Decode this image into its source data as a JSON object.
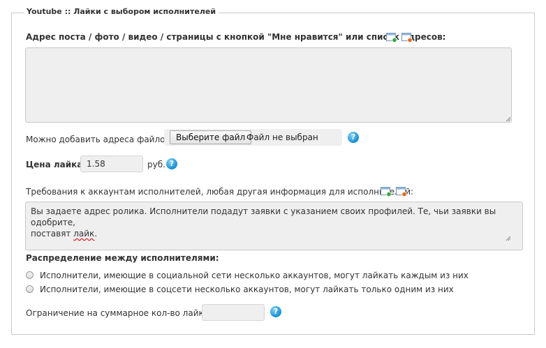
{
  "form": {
    "legend": "Youtube :: Лайки с выбором исполнителей",
    "post_address_label": "Адрес поста / фото / видео / страницы с кнопкой \"Мне нравится\" или список адресов:",
    "post_address_value": "",
    "file_label": "Можно добавить адреса файлом:",
    "file_button": "Выберите файл",
    "file_status": "Файл не выбран",
    "price_label": "Цена лайка:",
    "price_value": "1.58",
    "price_unit": "руб.",
    "requirements_label": "Требования к аккаунтам исполнителей, любая другая информация для исполнителей:",
    "requirements_text_1": "Вы задаете адрес ролика. Исполнители подадут заявки с указанием своих профилей. Те, чьи заявки вы одобрите,",
    "requirements_text_2_a": "поставят ",
    "requirements_text_2_b": "лайк",
    "requirements_text_2_c": ".",
    "distribution_label": "Распределение между исполнителями:",
    "distribution_options": [
      "Исполнители, имеющие в социальной сети несколько аккаунтов, могут лайкать каждым из них",
      "Исполнители, имеющие в соцсети несколько аккаунтов, могут лайкать только одним из них"
    ],
    "limit_label": "Ограничение на суммарное кол-во лайков:",
    "limit_value": "",
    "help_glyph": "?"
  },
  "icons": [
    "window-add-icon",
    "window-remove-icon",
    "help-icon",
    "resize-grip-icon"
  ],
  "colors": {
    "help_blue": "#1b8fd1",
    "field_bg": "#efefef",
    "border": "#c9c9c9",
    "add_green": "#3aa63a",
    "remove_orange": "#e36a1e"
  }
}
